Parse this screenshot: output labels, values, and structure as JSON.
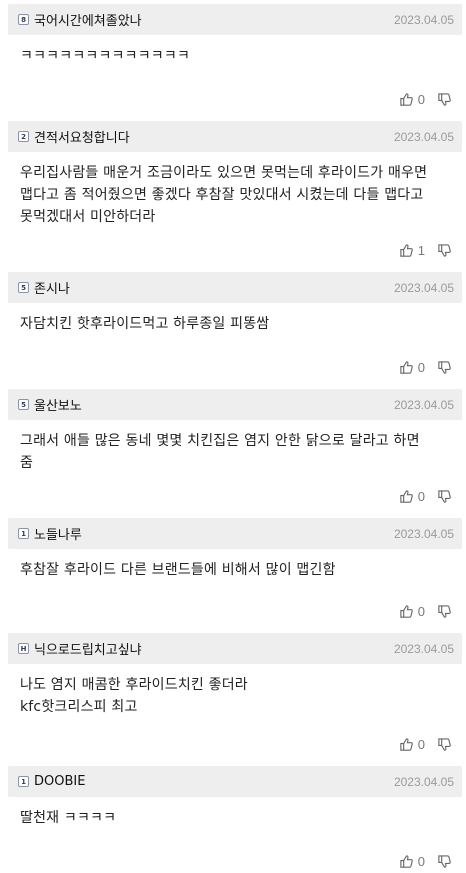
{
  "comments": [
    {
      "level": "8",
      "nickname": "국어시간에쳐졸았나",
      "date": "2023.04.05",
      "lines": [
        "ㅋㅋㅋㅋㅋㅋㅋㅋㅋㅋㅋㅋㅋ"
      ],
      "likes": "0"
    },
    {
      "level": "2",
      "nickname": "견적서요청합니다",
      "date": "2023.04.05",
      "lines": [
        "우리집사람들 매운거 조금이라도 있으면 못먹는데 후라이드가 매우면",
        "맵다고 좀 적어줬으면 좋겠다 후참잘 맛있대서 시켰는데 다들 맵다고",
        "못먹겠대서 미안하더라"
      ],
      "likes": "1"
    },
    {
      "level": "5",
      "nickname": "존시나",
      "date": "2023.04.05",
      "lines": [
        "자담치킨 핫후라이드먹고 하루종일 피똥쌈"
      ],
      "likes": "0"
    },
    {
      "level": "5",
      "nickname": "울산보노",
      "date": "2023.04.05",
      "lines": [
        "그래서 애들 많은 동네 몇몇 치킨집은 염지 안한 닭으로 달라고 하면",
        "줌"
      ],
      "likes": "0"
    },
    {
      "level": "1",
      "nickname": "노들나루",
      "date": "2023.04.05",
      "lines": [
        "후참잘 후라이드 다른 브랜드들에 비해서 많이 맵긴함"
      ],
      "likes": "0"
    },
    {
      "level": "H",
      "nickname": "닉으로드립치고싶냐",
      "date": "2023.04.05",
      "lines": [
        "나도 염지 매콤한 후라이드치킨 좋더라",
        "kfc핫크리스피 최고"
      ],
      "likes": "0"
    },
    {
      "level": "1",
      "nickname": "DOOBIE",
      "date": "2023.04.05",
      "lines": [
        "딸천재 ㅋㅋㅋㅋ"
      ],
      "likes": "0"
    }
  ],
  "icons": {
    "like": "thumbs-up-icon",
    "dislike": "thumbs-down-icon"
  },
  "colors": {
    "header_bg": "#eeeeee",
    "date": "#9a9a9a",
    "icon": "#666666"
  }
}
